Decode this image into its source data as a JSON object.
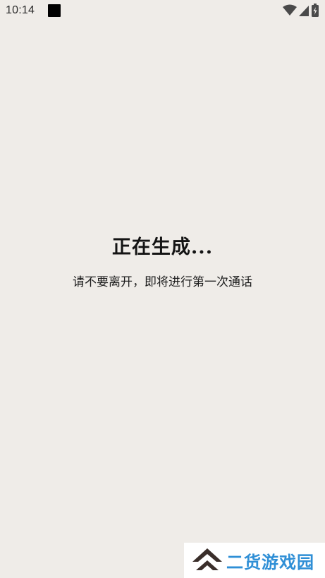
{
  "status_bar": {
    "time": "10:14",
    "icons": [
      "notification-square-icon",
      "wifi-icon",
      "cellular-signal-icon",
      "battery-icon"
    ]
  },
  "main": {
    "title": "正在生成...",
    "subtitle": "请不要离开，即将进行第一次通话"
  },
  "watermark": {
    "text": "二货游戏园",
    "colors": {
      "text": "#2f8fd6",
      "logo": "#3a2e2a"
    }
  },
  "colors": {
    "background": "#efece8",
    "title": "#141414"
  }
}
